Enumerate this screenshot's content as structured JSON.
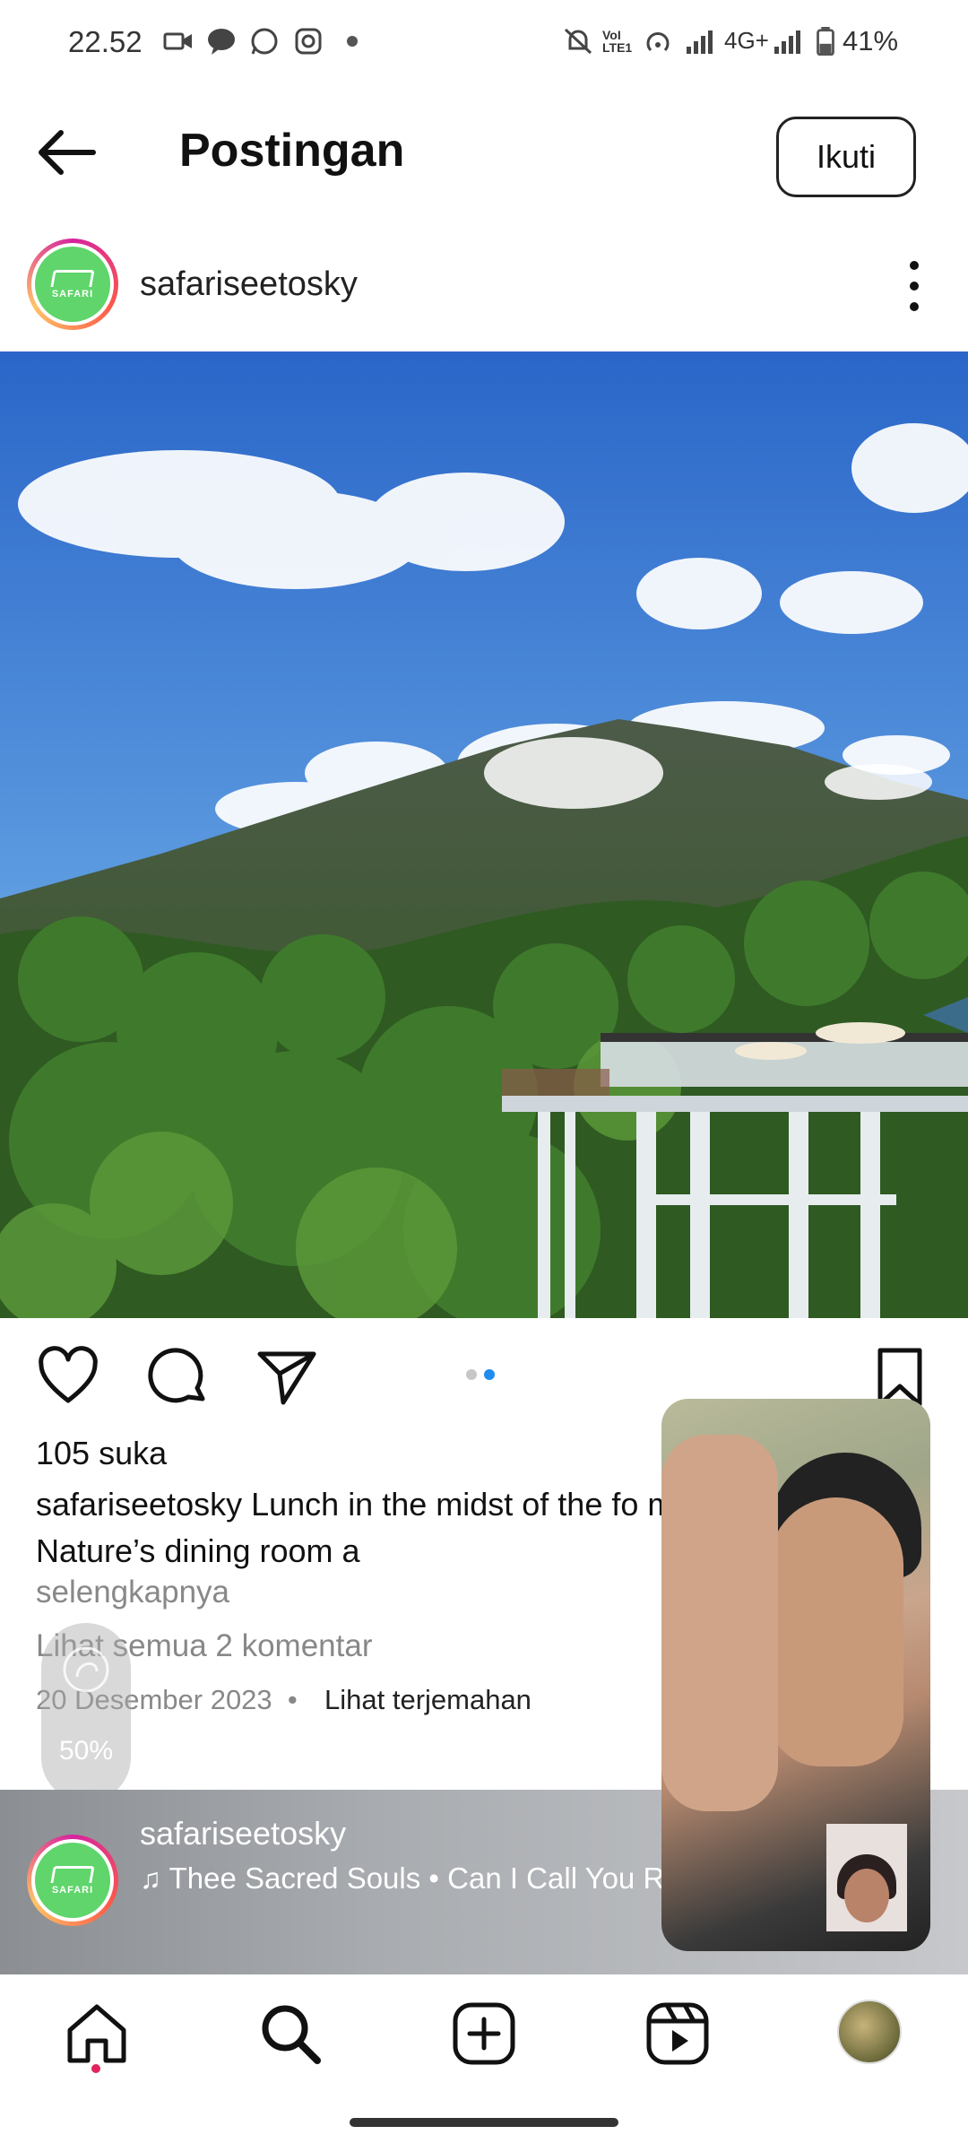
{
  "status_bar": {
    "time": "22.52",
    "battery_percent": "41%",
    "network": "4G+",
    "volte_label": "VoI LTE1",
    "icons": [
      "video-icon",
      "chat-icon",
      "whatsapp-icon",
      "instagram-icon",
      "dot-icon",
      "mute-icon",
      "volte-icon",
      "hotspot-icon",
      "signal-icon",
      "signal2-icon",
      "battery-icon"
    ]
  },
  "header": {
    "title": "Postingan",
    "follow_label": "Ikuti",
    "back_icon": "arrow-left-icon"
  },
  "post": {
    "author": "safariseetosky",
    "avatar_text": "SAFARI",
    "likes": "105 suka",
    "caption": "safariseetosky Lunch in the midst of the fo mountainous view. Nature’s dining room a",
    "more_label": "selengkapnya",
    "comments_label": "Lihat semua 2 komentar",
    "date": "20 Desember 2023",
    "translate_label": "Lihat terjemahan",
    "carousel": {
      "count": 2,
      "active": 2
    }
  },
  "meter": {
    "label": "50%"
  },
  "next_post": {
    "author": "safariseetosky",
    "song": "Thee Sacred Souls • Can I Call You Ro"
  },
  "bottom_nav": {
    "items": [
      "home-icon",
      "search-icon",
      "create-icon",
      "reels-icon",
      "profile-avatar"
    ],
    "active": "search"
  },
  "colors": {
    "accent": "#1f8cf0",
    "notification": "#e0245e"
  }
}
